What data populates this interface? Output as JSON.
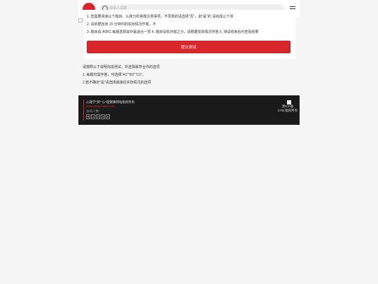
{
  "header": {
    "search_placeholder": "请输入关键"
  },
  "form": {
    "line1": "1. 您需要阅读以下题目，认真分析答题注意事项，不同意的请选择\"否\"，如\"是\"的 请完成以下测",
    "line2": "2. 请依据自身 15 分钟内的实际情况作答，不",
    "line3": "3. 题目请 A\\B\\C 每题选择其中最适合一项 4. 题目没有对错之分，请根据实际情况作答 5. 测试结束后可查看结果",
    "submit_label": "提交测试"
  },
  "notes": {
    "heading": "请按照以下说明完成测试，并选择最符合你的选项",
    "item1": "1. 每题均需作答，可选择\"A1\"\"B2\"\"C3\"。",
    "item2": "2.若不确定\"是\"请选择最接近实际情况的选项"
  },
  "footer": {
    "tagline": "心理学\"测\"\"心\"理健康网站版权所有",
    "url": "www.cpsychtest.com",
    "counter_label": "访问人数：",
    "digits": [
      "9",
      "1",
      "2",
      "3",
      "0"
    ],
    "right_line1": "浙ICP备",
    "right_line2": "CTB 版权所有"
  },
  "colors": {
    "accent": "#d9262a",
    "footer_bg": "#1a1a1a"
  }
}
